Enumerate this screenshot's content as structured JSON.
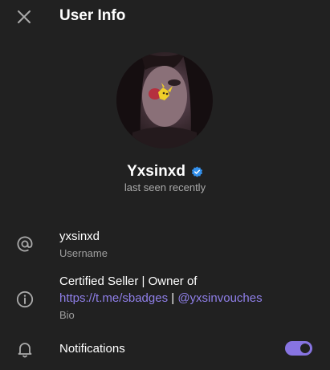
{
  "header": {
    "title": "User Info",
    "close_icon": "close-icon"
  },
  "profile": {
    "name": "Yxsinxd",
    "verified": true,
    "status": "last seen recently"
  },
  "username_row": {
    "icon": "at-icon",
    "value": "yxsinxd",
    "label": "Username"
  },
  "bio_row": {
    "icon": "info-icon",
    "text": "Certified Seller | Owner of",
    "link1": "https://t.me/sbadges",
    "separator": "|",
    "link2": "@yxsinvouches",
    "label": "Bio"
  },
  "notifications_row": {
    "icon": "bell-icon",
    "label": "Notifications",
    "enabled": true
  },
  "colors": {
    "background": "#212121",
    "accent": "#8774e1",
    "link": "#8f7fe8",
    "verified": "#3390ec"
  }
}
